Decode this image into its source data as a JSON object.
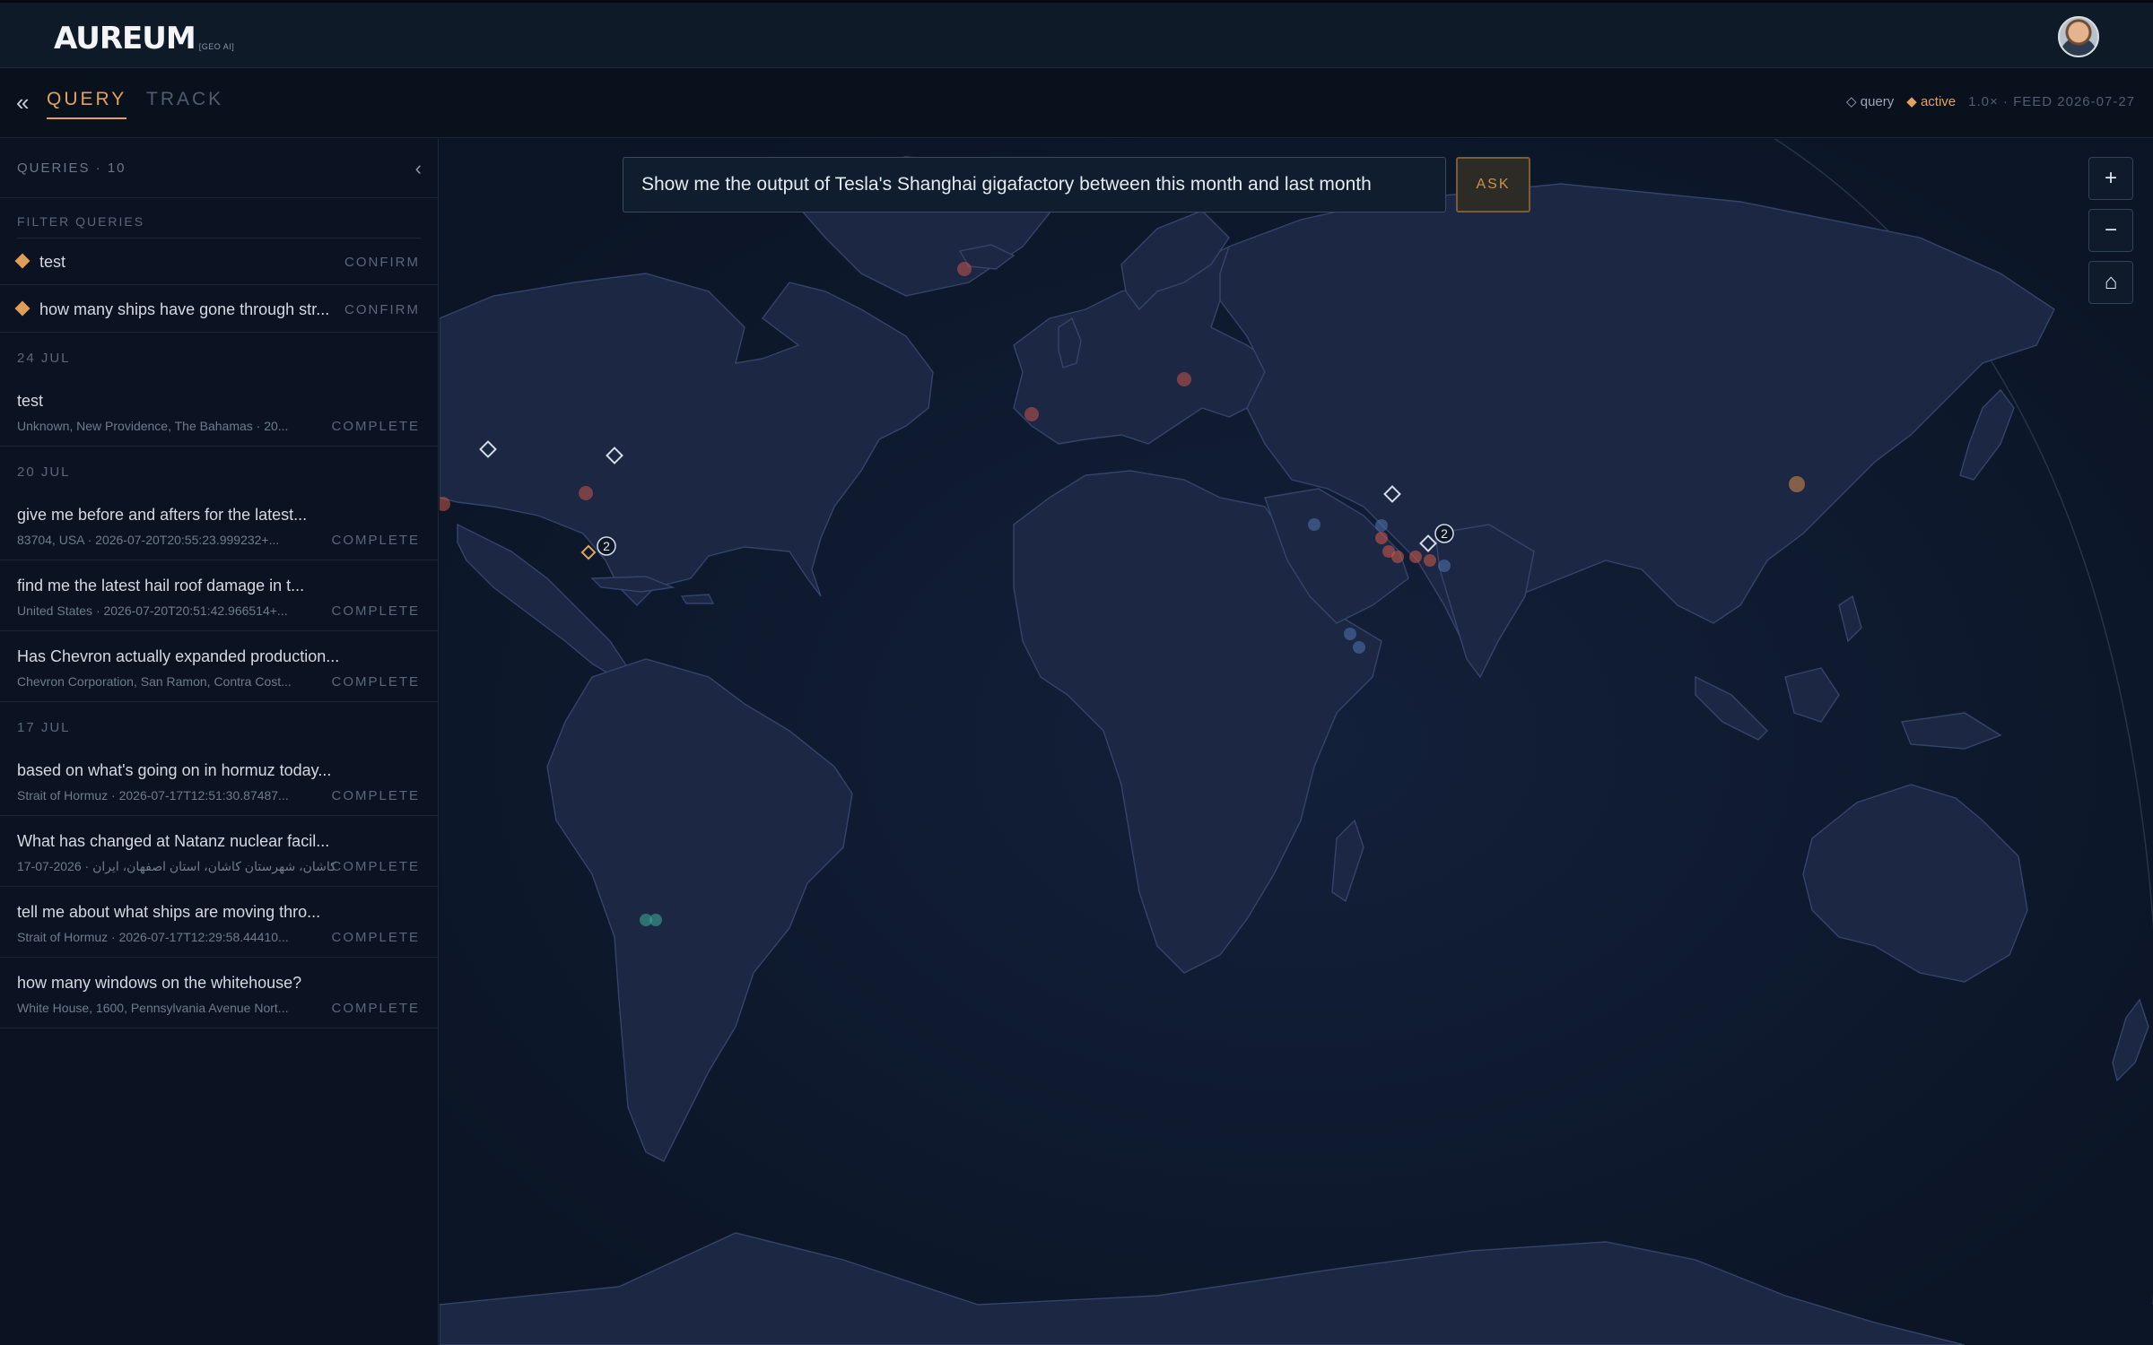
{
  "header": {
    "logo": "AUREUM",
    "logo_sub": "[GEO AI]"
  },
  "tabs": {
    "back_icon": "«",
    "query": "QUERY",
    "track": "TRACK"
  },
  "legend": {
    "query": "◇ query",
    "active": "◆ active",
    "feed": "1.0× · FEED 2026-07-27"
  },
  "sidebar": {
    "count_label": "QUERIES · 10",
    "collapse_icon": "‹",
    "filter_placeholder": "FILTER QUERIES",
    "pending": [
      {
        "title": "test",
        "status": "CONFIRM"
      },
      {
        "title": "how many ships have gone through str...",
        "status": "CONFIRM"
      }
    ],
    "groups": [
      {
        "date": "24 JUL",
        "items": [
          {
            "title": "test",
            "sub": "Unknown, New Providence, The Bahamas · 20...",
            "status": "COMPLETE"
          }
        ]
      },
      {
        "date": "20 JUL",
        "items": [
          {
            "title": "give me before and afters for the latest...",
            "sub": "83704, USA · 2026-07-20T20:55:23.999232+...",
            "status": "COMPLETE"
          },
          {
            "title": "find me the latest hail roof damage in t...",
            "sub": "United States · 2026-07-20T20:51:42.966514+...",
            "status": "COMPLETE"
          },
          {
            "title": "Has Chevron actually expanded production...",
            "sub": "Chevron Corporation, San Ramon, Contra Cost...",
            "status": "COMPLETE"
          }
        ]
      },
      {
        "date": "17 JUL",
        "items": [
          {
            "title": "based on what's going on in hormuz today...",
            "sub": "Strait of Hormuz · 2026-07-17T12:51:30.87487...",
            "status": "COMPLETE"
          },
          {
            "title": "What has changed at Natanz nuclear facil...",
            "sub": "17-07-2026 · کاشان، شهرستان کاشان، استان اصفهان، ایران",
            "status": "COMPLETE"
          },
          {
            "title": "tell me about what ships are moving thro...",
            "sub": "Strait of Hormuz · 2026-07-17T12:29:58.44410...",
            "status": "COMPLETE"
          },
          {
            "title": "how many windows on the whitehouse?",
            "sub": "White House, 1600, Pennsylvania Avenue Nort...",
            "status": "COMPLETE"
          }
        ]
      }
    ]
  },
  "map": {
    "query_value": "Show me the output of Tesla's Shanghai gigafactory between this month and last month",
    "ask_label": "ASK",
    "zoom_in": "+",
    "zoom_out": "−",
    "home_icon": "⌂",
    "cluster_badges": [
      "2",
      "2"
    ]
  },
  "colors": {
    "accent": "#e0a35e",
    "background": "#0b1322",
    "land": "#1a2640",
    "marker_red": "#c7584a",
    "marker_blue": "#4c6fa8",
    "marker_teal": "#3ea392"
  }
}
